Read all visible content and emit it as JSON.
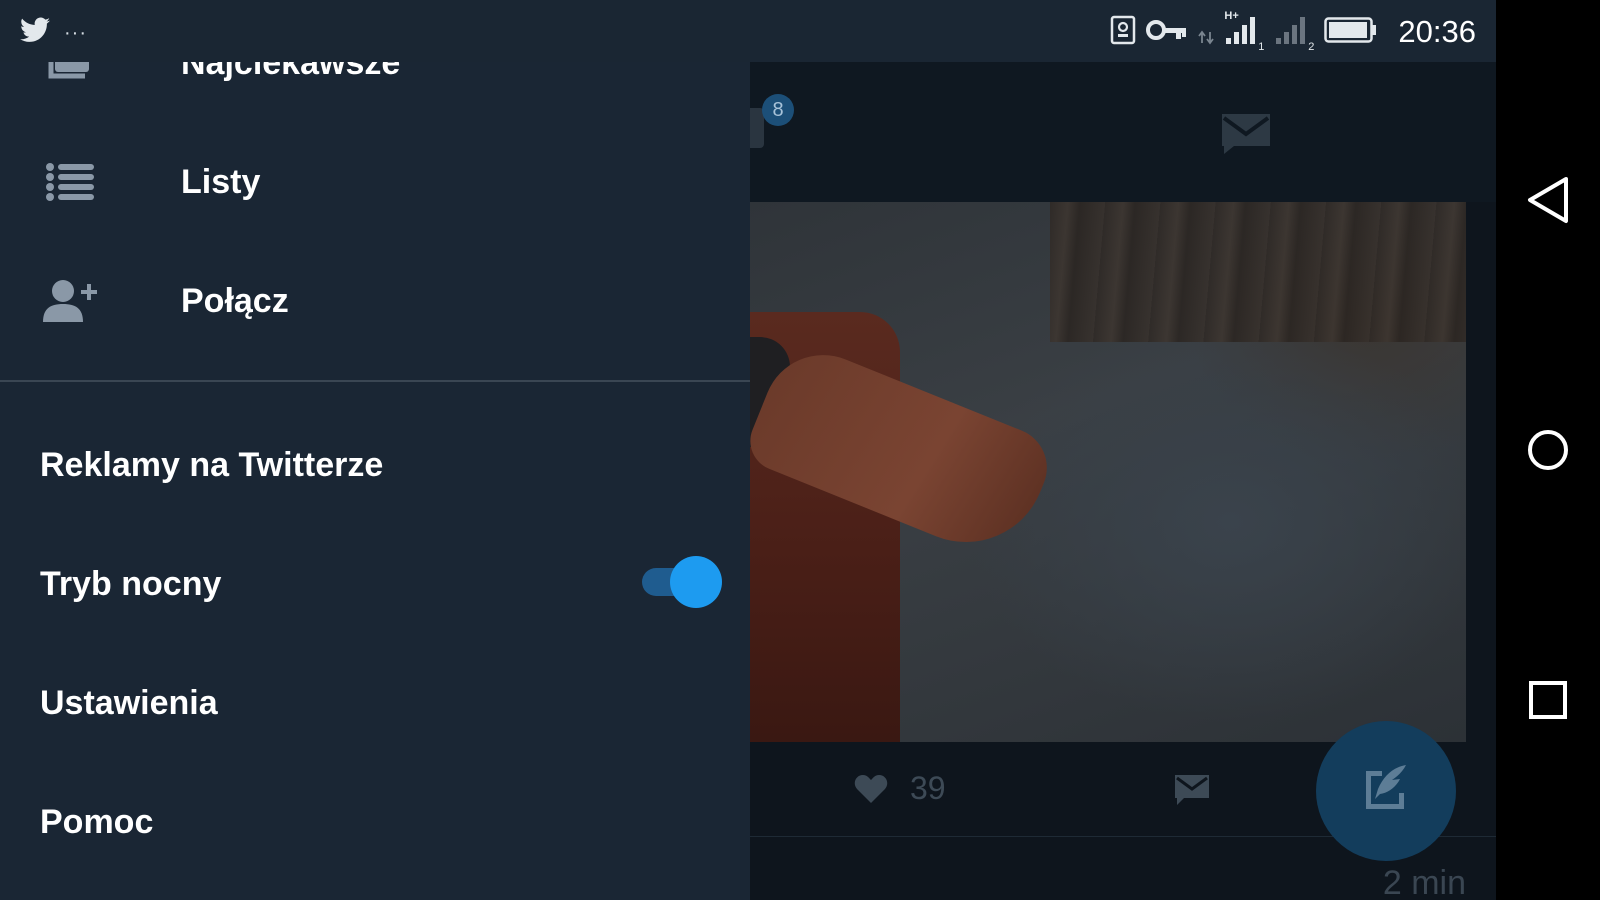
{
  "status_bar": {
    "time": "20:36",
    "more_indicator": "···",
    "signal_1_label": "H+",
    "sim_1": "1",
    "sim_2": "2"
  },
  "drawer": {
    "menu_items": [
      {
        "label": "Najciekawsze",
        "icon": "moments-icon"
      },
      {
        "label": "Listy",
        "icon": "list-icon"
      },
      {
        "label": "Połącz",
        "icon": "add-user-icon"
      }
    ],
    "secondary_items": [
      {
        "label": "Reklamy na Twitterze"
      },
      {
        "label": "Tryb nocny"
      },
      {
        "label": "Ustawienia"
      },
      {
        "label": "Pomoc"
      }
    ],
    "night_mode_enabled": true
  },
  "timeline": {
    "notification_badge": "8",
    "tweet": {
      "like_count": "39",
      "time": "2 min"
    }
  },
  "colors": {
    "drawer_bg": "#1a2634",
    "status_bar_bg": "#1a2633",
    "accent": "#1d9bf0",
    "toggle_track": "#1f5c8f"
  }
}
